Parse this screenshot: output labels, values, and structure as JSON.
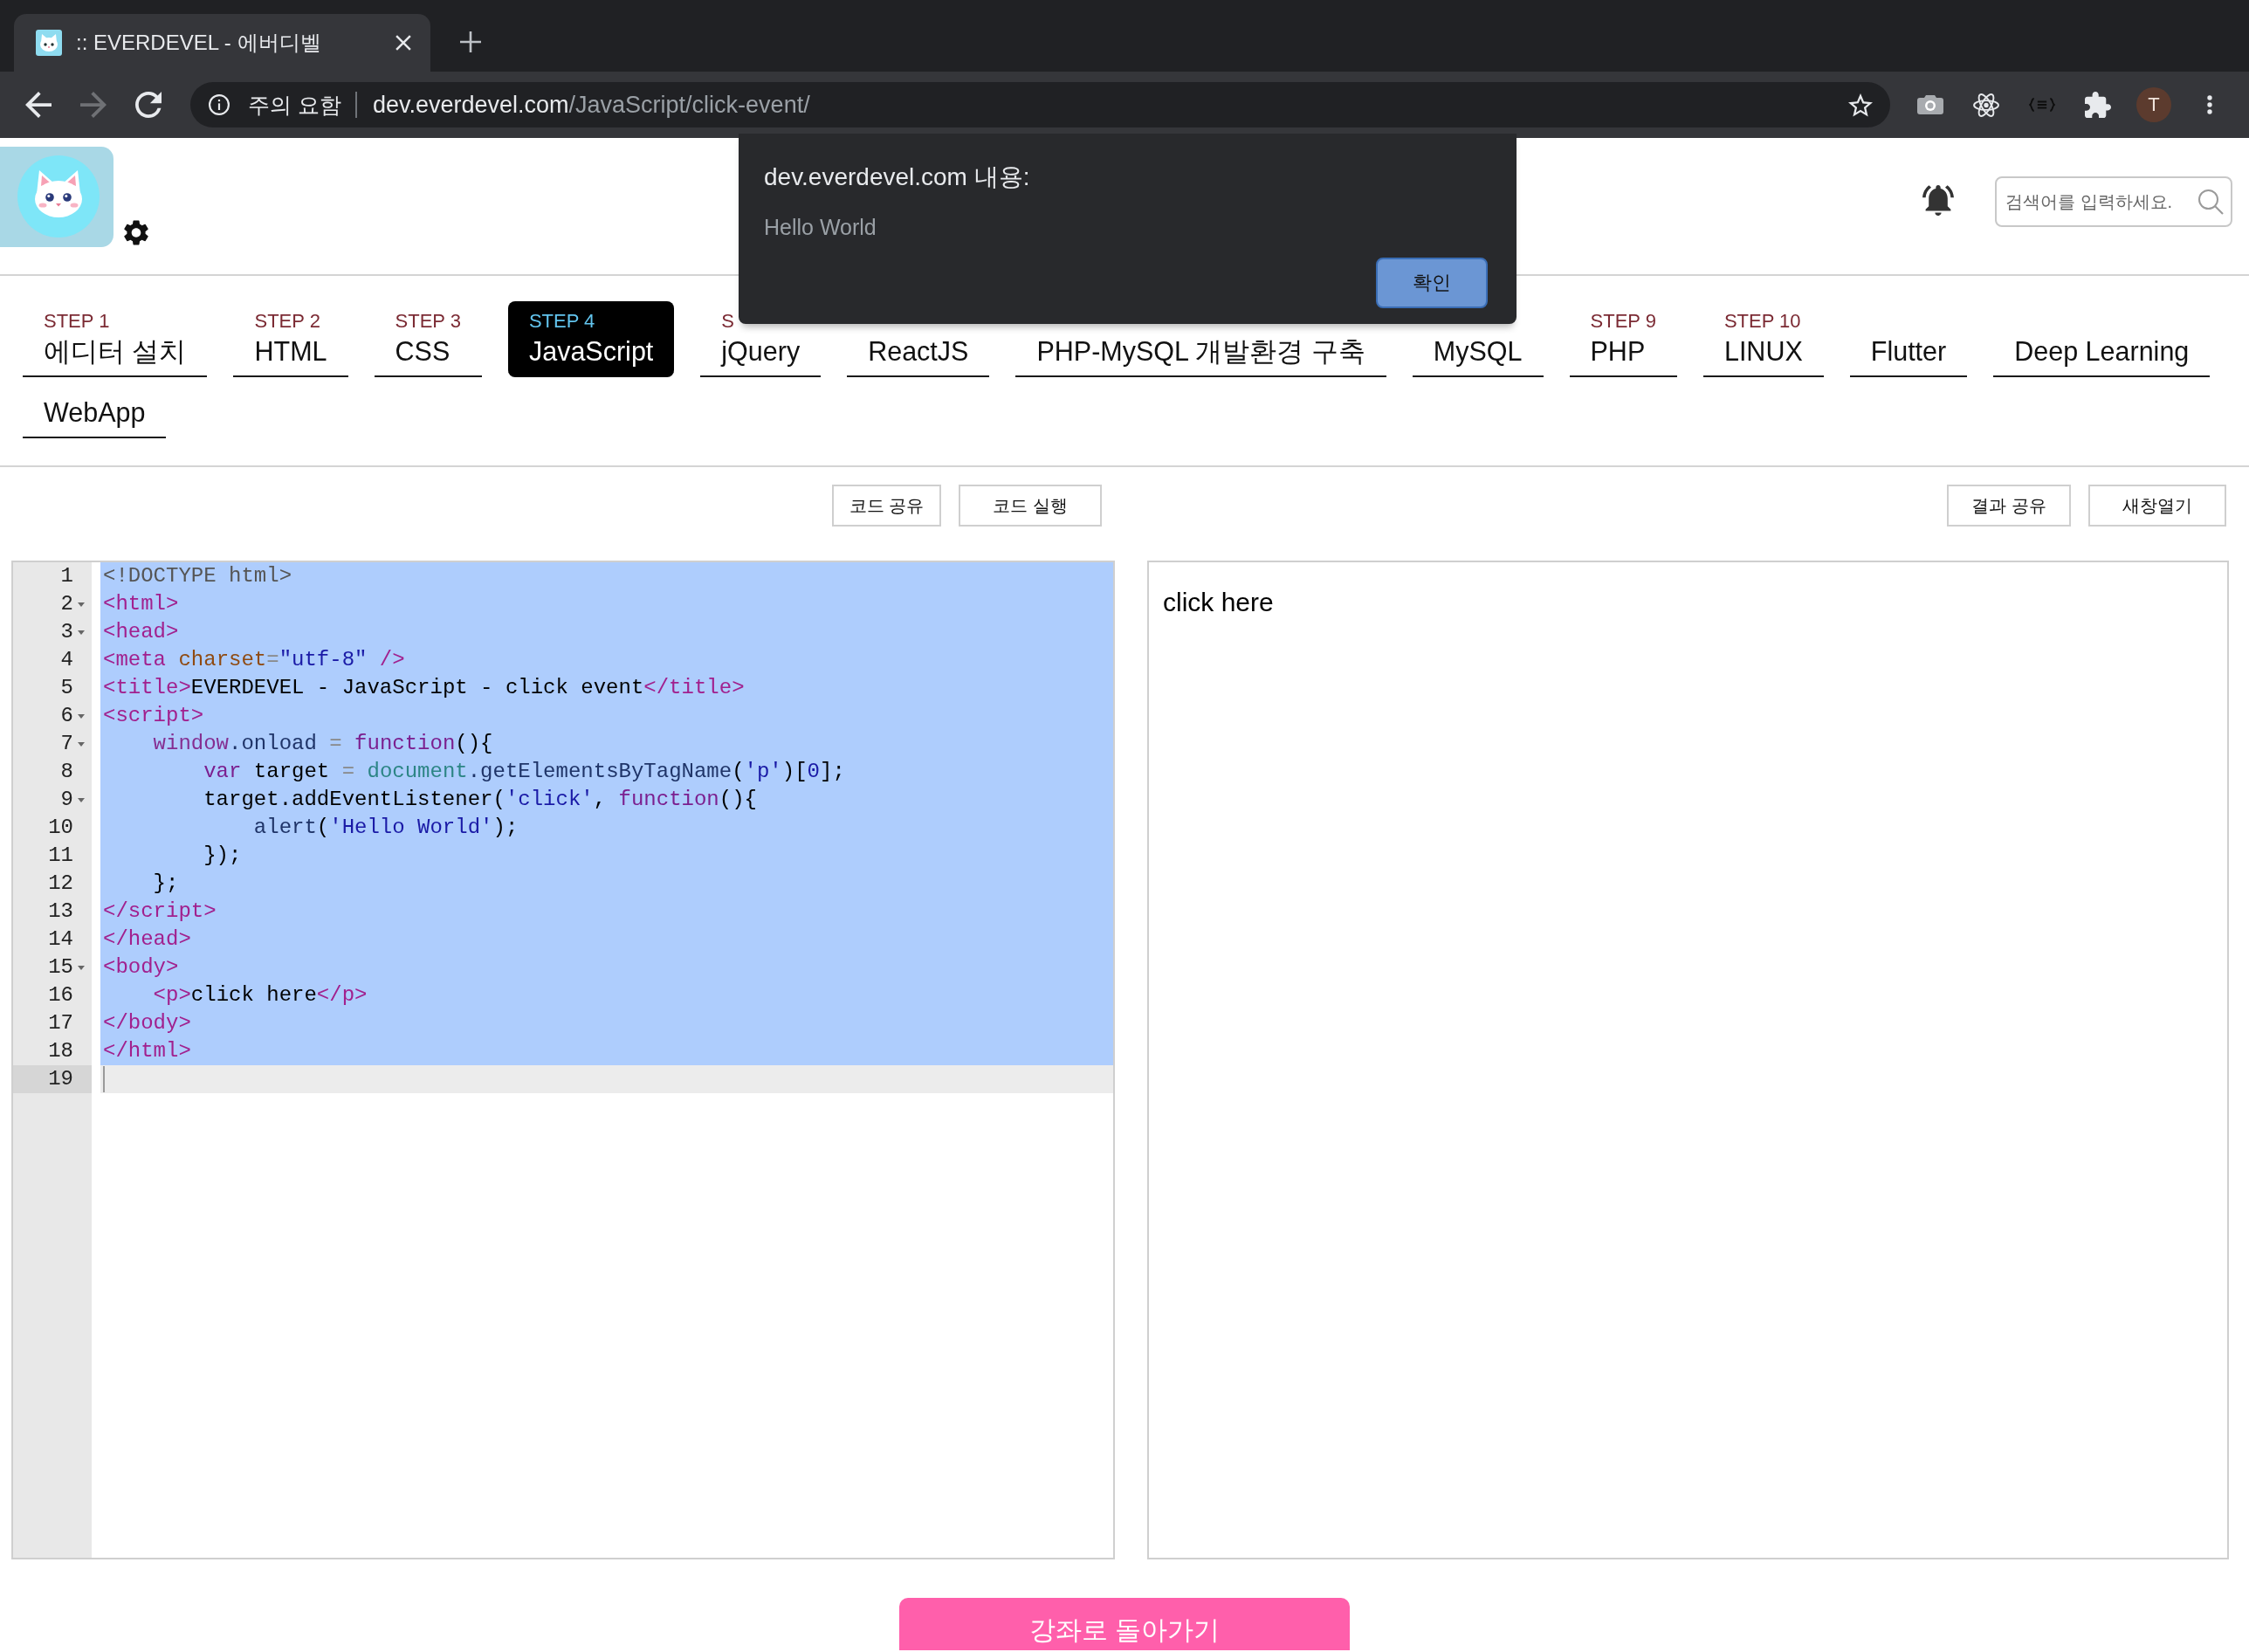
{
  "browser": {
    "tab_title": ":: EVERDEVEL - 에버디벨",
    "nav_buttons": [
      {
        "kind": "back",
        "disabled": false
      },
      {
        "kind": "forward",
        "disabled": true
      },
      {
        "kind": "reload",
        "disabled": false
      }
    ],
    "security_label": "주의 요함",
    "url": {
      "host": "dev.everdevel.com",
      "path": "/JavaScript/click-event/"
    },
    "profile_initial": "T"
  },
  "header": {
    "search": {
      "placeholder": "검색어를 입력하세요."
    }
  },
  "steps": [
    {
      "step": "STEP 1",
      "label": "에디터 설치",
      "selected": false
    },
    {
      "step": "STEP 2",
      "label": "HTML",
      "selected": false
    },
    {
      "step": "STEP 3",
      "label": "CSS",
      "selected": false
    },
    {
      "step": "STEP 4",
      "label": "JavaScript",
      "selected": true
    },
    {
      "step": "S",
      "label": "jQuery",
      "selected": false
    },
    {
      "label": "ReactJS",
      "selected": false
    },
    {
      "label": "PHP-MySQL 개발환경 구축",
      "selected": false
    },
    {
      "label": "MySQL",
      "selected": false
    },
    {
      "step": "STEP 9",
      "label": "PHP",
      "selected": false
    },
    {
      "step": "STEP 10",
      "label": "LINUX",
      "selected": false
    },
    {
      "label": "Flutter",
      "selected": false
    },
    {
      "label": "Deep Learning",
      "selected": false
    },
    {
      "label": "WebApp",
      "selected": false
    }
  ],
  "editor": {
    "buttons": [
      "코드 공유",
      "코드 실행"
    ],
    "lines": [
      {
        "number": "1",
        "foldable": false,
        "selected": true,
        "cursor": false,
        "tokens": [
          {
            "kind": "meta",
            "text": "<!DOCTYPE html>"
          }
        ]
      },
      {
        "number": "2",
        "foldable": true,
        "selected": true,
        "cursor": false,
        "tokens": [
          {
            "kind": "tag",
            "text": "<html>"
          }
        ]
      },
      {
        "number": "3",
        "foldable": true,
        "selected": true,
        "cursor": false,
        "tokens": [
          {
            "kind": "tag",
            "text": "<head>"
          }
        ]
      },
      {
        "number": "4",
        "foldable": false,
        "selected": true,
        "cursor": false,
        "tokens": [
          {
            "kind": "tag",
            "text": "<meta"
          },
          {
            "kind": "attr",
            "text": " charset"
          },
          {
            "kind": "op",
            "text": "="
          },
          {
            "kind": "string",
            "text": "\"utf-8\""
          },
          {
            "kind": "tag",
            "text": " />"
          }
        ]
      },
      {
        "number": "5",
        "foldable": false,
        "selected": true,
        "cursor": false,
        "tokens": [
          {
            "kind": "tag",
            "text": "<title>"
          },
          {
            "kind": "plain",
            "text": "EVERDEVEL - JavaScript - click event"
          },
          {
            "kind": "tag",
            "text": "</title>"
          }
        ]
      },
      {
        "number": "6",
        "foldable": true,
        "selected": true,
        "cursor": false,
        "tokens": [
          {
            "kind": "tag",
            "text": "<script>"
          }
        ]
      },
      {
        "number": "7",
        "foldable": true,
        "selected": true,
        "cursor": false,
        "tokens": [
          {
            "kind": "variable",
            "text": "    window"
          },
          {
            "kind": "property",
            "text": ".onload"
          },
          {
            "kind": "op",
            "text": " = "
          },
          {
            "kind": "keyword",
            "text": "function"
          },
          {
            "kind": "plain",
            "text": "(){"
          }
        ]
      },
      {
        "number": "8",
        "foldable": false,
        "selected": true,
        "cursor": false,
        "tokens": [
          {
            "kind": "keyword",
            "text": "        var"
          },
          {
            "kind": "plain",
            "text": " target"
          },
          {
            "kind": "op",
            "text": " = "
          },
          {
            "kind": "builtin",
            "text": "document"
          },
          {
            "kind": "property",
            "text": ".getElementsByTagName"
          },
          {
            "kind": "plain",
            "text": "("
          },
          {
            "kind": "string",
            "text": "'p'"
          },
          {
            "kind": "plain",
            "text": ")["
          },
          {
            "kind": "number",
            "text": "0"
          },
          {
            "kind": "plain",
            "text": "];"
          }
        ]
      },
      {
        "number": "9",
        "foldable": true,
        "selected": true,
        "cursor": false,
        "tokens": [
          {
            "kind": "plain",
            "text": "        target.addEventListener("
          },
          {
            "kind": "string",
            "text": "'click'"
          },
          {
            "kind": "plain",
            "text": ", "
          },
          {
            "kind": "keyword",
            "text": "function"
          },
          {
            "kind": "plain",
            "text": "(){"
          }
        ]
      },
      {
        "number": "10",
        "foldable": false,
        "selected": true,
        "cursor": false,
        "tokens": [
          {
            "kind": "property",
            "text": "            alert"
          },
          {
            "kind": "plain",
            "text": "("
          },
          {
            "kind": "string",
            "text": "'Hello World'"
          },
          {
            "kind": "plain",
            "text": ");"
          }
        ]
      },
      {
        "number": "11",
        "foldable": false,
        "selected": true,
        "cursor": false,
        "tokens": [
          {
            "kind": "plain",
            "text": "        });"
          }
        ]
      },
      {
        "number": "12",
        "foldable": false,
        "selected": true,
        "cursor": false,
        "tokens": [
          {
            "kind": "plain",
            "text": "    };"
          }
        ]
      },
      {
        "number": "13",
        "foldable": false,
        "selected": true,
        "cursor": false,
        "tokens": [
          {
            "kind": "tag",
            "text": "</script>"
          }
        ]
      },
      {
        "number": "14",
        "foldable": false,
        "selected": true,
        "cursor": false,
        "tokens": [
          {
            "kind": "tag",
            "text": "</head>"
          }
        ]
      },
      {
        "number": "15",
        "foldable": true,
        "selected": true,
        "cursor": false,
        "tokens": [
          {
            "kind": "tag",
            "text": "<body>"
          }
        ]
      },
      {
        "number": "16",
        "foldable": false,
        "selected": true,
        "cursor": false,
        "tokens": [
          {
            "kind": "tag",
            "text": "    <p>"
          },
          {
            "kind": "plain",
            "text": "click here"
          },
          {
            "kind": "tag",
            "text": "</p>"
          }
        ]
      },
      {
        "number": "17",
        "foldable": false,
        "selected": true,
        "cursor": false,
        "tokens": [
          {
            "kind": "tag",
            "text": "</body>"
          }
        ]
      },
      {
        "number": "18",
        "foldable": false,
        "selected": true,
        "cursor": false,
        "tokens": [
          {
            "kind": "tag",
            "text": "</html>"
          }
        ]
      },
      {
        "number": "19",
        "foldable": false,
        "selected": false,
        "cursor": true
      }
    ]
  },
  "result": {
    "buttons": [
      "결과 공유",
      "새창열기"
    ],
    "text": "click here"
  },
  "back_button": {
    "label": "강좌로 돌아가기"
  },
  "dialog": {
    "title": "dev.everdevel.com 내용:",
    "message": "Hello World",
    "button": "확인"
  }
}
